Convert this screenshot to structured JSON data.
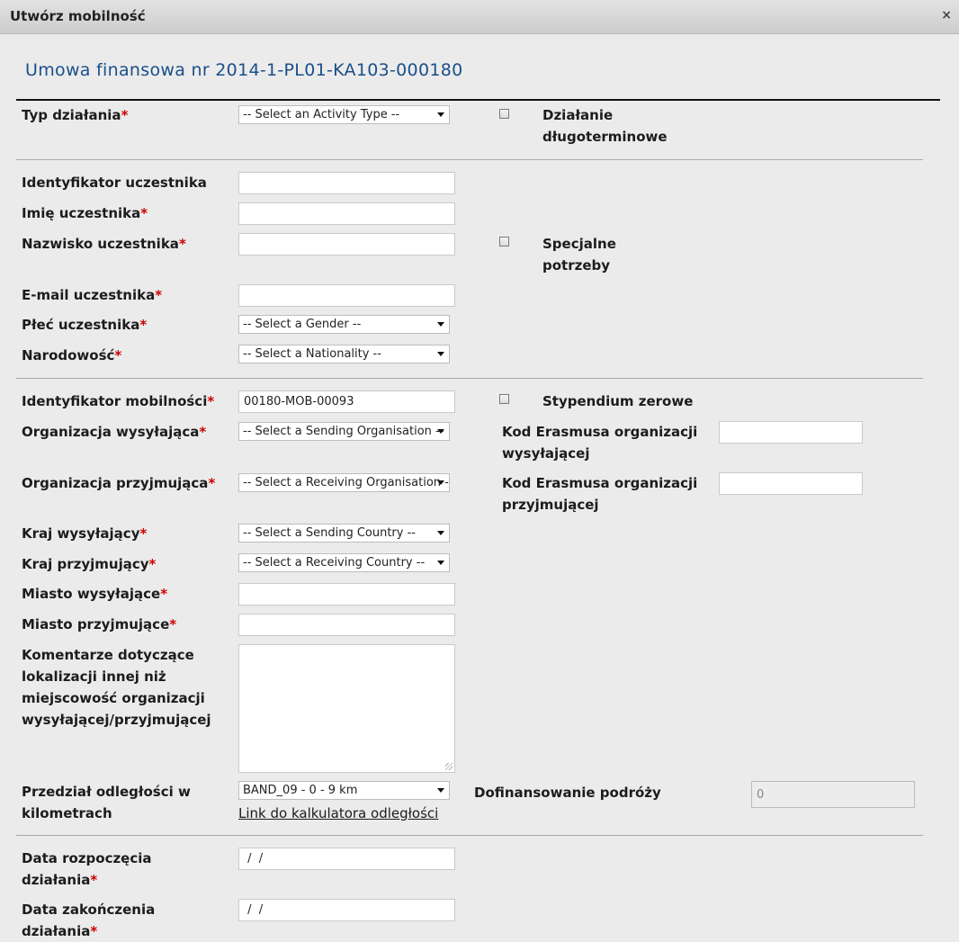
{
  "dialog": {
    "title": "Utwórz mobilność",
    "close_icon": "×"
  },
  "heading": "Umowa finansowa nr 2014-1-PL01-KA103-000180",
  "activity": {
    "type_label": "Typ działania",
    "type_select": "-- Select an Activity Type --",
    "longterm_label": "Działanie długoterminowe",
    "longterm_line1": "Działanie",
    "longterm_line2": "długoterminowe"
  },
  "participant": {
    "id_label": "Identyfikator uczestnika",
    "id_value": "",
    "firstname_label": "Imię uczestnika",
    "firstname_value": "",
    "lastname_label": "Nazwisko uczestnika",
    "lastname_value": "",
    "special_line1": "Specjalne",
    "special_line2": "potrzeby",
    "email_label": "E-mail uczestnika",
    "email_value": "",
    "gender_label": "Płeć uczestnika",
    "gender_select": "-- Select a Gender --",
    "nationality_label": "Narodowość",
    "nationality_select": "-- Select a Nationality --"
  },
  "mobility": {
    "id_label": "Identyfikator mobilności",
    "id_value": "00180-MOB-00093",
    "zero_grant_label": "Stypendium zerowe",
    "sending_org_label": "Organizacja wysyłająca",
    "sending_org_select": "-- Select a Sending Organisation --",
    "sending_code_line1": "Kod Erasmusa organizacji",
    "sending_code_line2": "wysyłającej",
    "sending_code_value": "",
    "receiving_org_label": "Organizacja przyjmująca",
    "receiving_org_select": "-- Select a Receiving Organisation --",
    "receiving_code_line1": "Kod Erasmusa organizacji",
    "receiving_code_line2": "przyjmującej",
    "receiving_code_value": "",
    "sending_country_label": "Kraj wysyłający",
    "sending_country_select": "-- Select a Sending Country --",
    "receiving_country_label": "Kraj przyjmujący",
    "receiving_country_select": "-- Select a Receiving Country --",
    "sending_city_label": "Miasto wysyłające",
    "sending_city_value": "",
    "receiving_city_label": "Miasto przyjmujące",
    "receiving_city_value": "",
    "comments_line1": "Komentarze dotyczące",
    "comments_line2": "lokalizacji innej niż",
    "comments_line3": "miejscowość organizacji",
    "comments_line4": "wysyłającej/przyjmującej",
    "distance_line1": "Przedział odległości w",
    "distance_line2": "kilometrach",
    "distance_select": "BAND_09 - 0 - 9 km",
    "distance_link": "Link do kalkulatora odległości",
    "travel_label": "Dofinansowanie podróży",
    "travel_value": "0"
  },
  "dates": {
    "start_line1": "Data rozpoczęcia",
    "start_line2": "działania",
    "start_value": " /  /",
    "end_line1": "Data zakończenia",
    "end_line2": "działania",
    "end_value": " /  /"
  }
}
